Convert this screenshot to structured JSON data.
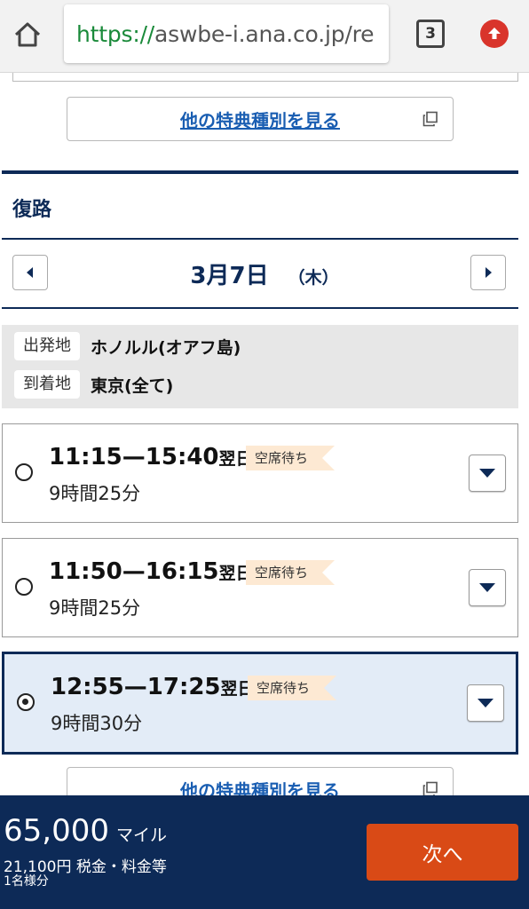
{
  "browser": {
    "url_scheme": "https://",
    "url_rest": "aswbe-i.ana.co.jp/re",
    "tab_count": "3"
  },
  "links": {
    "more_award_types": "他の特典種別を見る"
  },
  "section": {
    "title": "復路"
  },
  "date_nav": {
    "date": "3月7日",
    "weekday": "（木）"
  },
  "route": {
    "origin_label": "出発地",
    "origin_value": "ホノルル(オアフ島)",
    "dest_label": "到着地",
    "dest_value": "東京(全て)"
  },
  "flights": [
    {
      "time": "11:15—15:40",
      "next_day": "翌日",
      "status": "空席待ち",
      "duration": "9時間25分",
      "selected": false
    },
    {
      "time": "11:50—16:15",
      "next_day": "翌日",
      "status": "空席待ち",
      "duration": "9時間25分",
      "selected": false
    },
    {
      "time": "12:55—17:25",
      "next_day": "翌日",
      "status": "空席待ち",
      "duration": "9時間30分",
      "selected": true
    }
  ],
  "summary": {
    "miles": "65,000",
    "miles_unit": "マイル",
    "tax": "21,100円 税金・料金等",
    "pax": "1名様分",
    "next_label": "次へ"
  },
  "colors": {
    "navy": "#0d2a57",
    "link": "#1a5eb2",
    "accent": "#d94a16",
    "badge": "#fde9d3",
    "selected_bg": "#e3ecf7"
  },
  "icons": {
    "home": "home-icon",
    "upload": "upload-arrow-icon",
    "external": "external-link-icon",
    "prev": "caret-left-icon",
    "next": "caret-right-icon",
    "expand": "caret-down-icon"
  }
}
